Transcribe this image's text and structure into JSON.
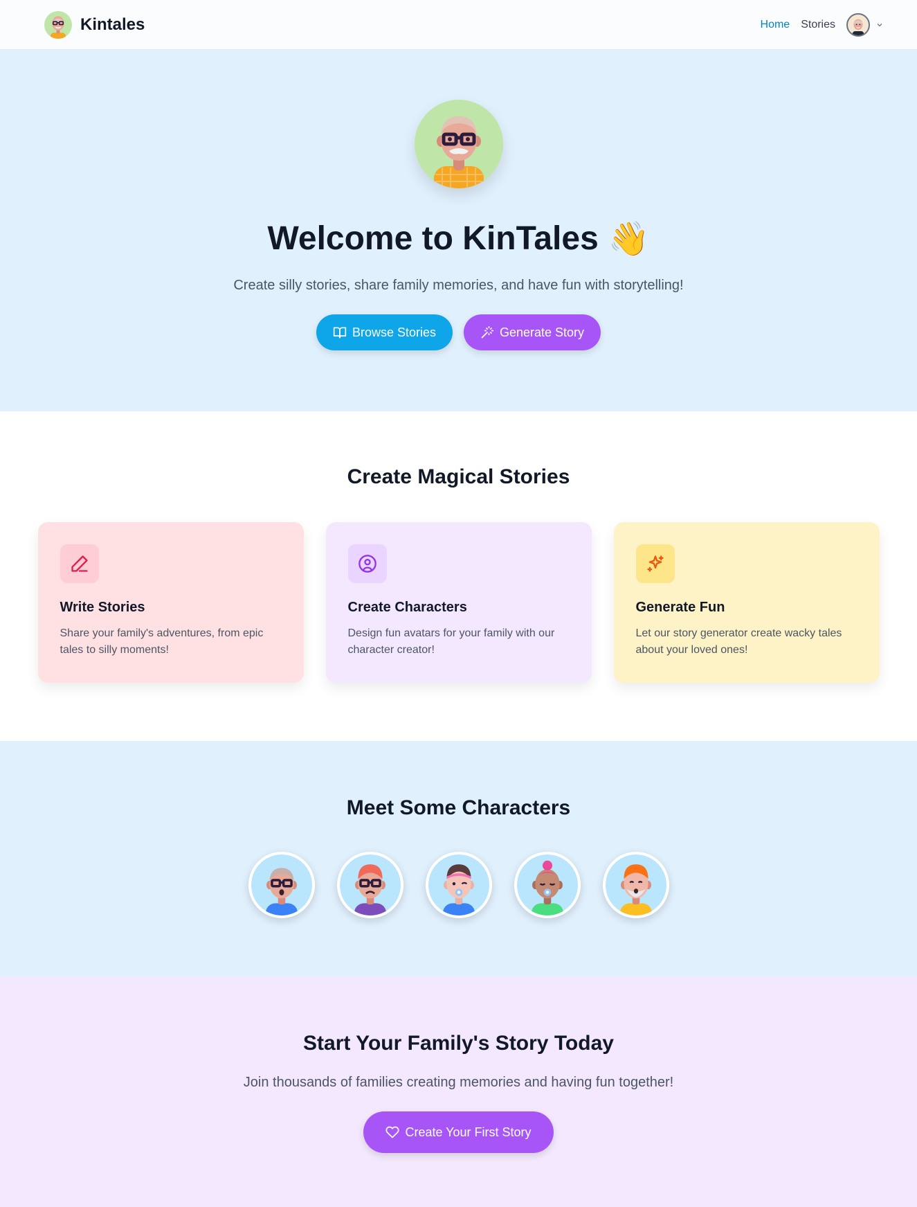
{
  "nav": {
    "brand": "Kintales",
    "links": [
      {
        "label": "Home",
        "active": true
      },
      {
        "label": "Stories",
        "active": false
      }
    ]
  },
  "hero": {
    "title": "Welcome to KinTales",
    "emoji": "👋",
    "subtitle": "Create silly stories, share family memories, and have fun with storytelling!",
    "browse_label": "Browse Stories",
    "generate_label": "Generate Story"
  },
  "features": {
    "title": "Create Magical Stories",
    "cards": [
      {
        "title": "Write Stories",
        "text": "Share your family's adventures, from epic tales to silly moments!",
        "icon": "pen-icon"
      },
      {
        "title": "Create Characters",
        "text": "Design fun avatars for your family with our character creator!",
        "icon": "user-circle-icon"
      },
      {
        "title": "Generate Fun",
        "text": "Let our story generator create wacky tales about your loved ones!",
        "icon": "sparkles-icon"
      }
    ]
  },
  "characters": {
    "title": "Meet Some Characters"
  },
  "cta": {
    "title": "Start Your Family's Story Today",
    "subtitle": "Join thousands of families creating memories and having fun together!",
    "button_label": "Create Your First Story"
  },
  "colors": {
    "accent_blue": "#0ea5e9",
    "accent_purple": "#a855f7",
    "active_link": "#0284c7"
  }
}
